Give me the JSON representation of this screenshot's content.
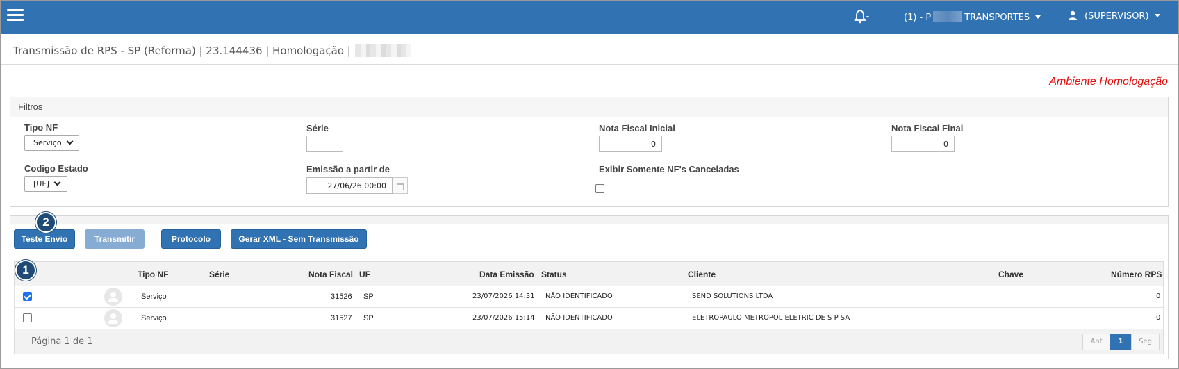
{
  "header": {
    "company_prefix": "(1) - P",
    "company_suffix": "TRANSPORTES",
    "user": "(SUPERVISOR)"
  },
  "page": {
    "title": "Transmissão de RPS - SP (Reforma) | 23.144436 | Homologação |",
    "environment": "Ambiente Homologação"
  },
  "filters": {
    "title": "Filtros",
    "tipo_nf": {
      "label": "Tipo NF",
      "value": "Serviço"
    },
    "serie": {
      "label": "Série",
      "value": ""
    },
    "nf_inicial": {
      "label": "Nota Fiscal Inicial",
      "value": "0"
    },
    "nf_final": {
      "label": "Nota Fiscal Final",
      "value": "0"
    },
    "codigo_estado": {
      "label": "Codigo Estado",
      "value": "[UF]"
    },
    "emissao": {
      "label": "Emissão a partir de",
      "value": "27/06/26 00:00"
    },
    "somente_canceladas": {
      "label": "Exibir Somente NF's Canceladas",
      "checked": false
    }
  },
  "toolbar": {
    "teste_envio": "Teste Envio",
    "transmitir": "Transmitir",
    "protocolo": "Protocolo",
    "gerar_xml": "Gerar XML - Sem Transmissão"
  },
  "markers": {
    "one": "1",
    "two": "2"
  },
  "table": {
    "columns": [
      "Tipo NF",
      "Série",
      "Nota Fiscal",
      "UF",
      "Data Emissão",
      "Status",
      "Cliente",
      "Chave",
      "Número RPS"
    ],
    "rows": [
      {
        "checked": true,
        "tipo_nf": "Serviço",
        "serie": "",
        "nota_fiscal": "31526",
        "uf": "SP",
        "data_emissao": "23/07/2026 14:31",
        "status": "NÃO IDENTIFICADO",
        "cliente": "SEND SOLUTIONS LTDA",
        "chave": "",
        "numero_rps": "0"
      },
      {
        "checked": false,
        "tipo_nf": "Serviço",
        "serie": "",
        "nota_fiscal": "31527",
        "uf": "SP",
        "data_emissao": "23/07/2026 15:14",
        "status": "NÃO IDENTIFICADO",
        "cliente": "ELETROPAULO METROPOL ELETRIC DE S P SA",
        "chave": "",
        "numero_rps": "0"
      }
    ],
    "page_info": "Página 1 de 1",
    "pager": {
      "prev": "Ant",
      "current": "1",
      "next": "Seg"
    }
  },
  "colors": {
    "header_bg": "#3172b3",
    "env_text": "#e30d0d",
    "marker_bg": "#1e4b77"
  }
}
